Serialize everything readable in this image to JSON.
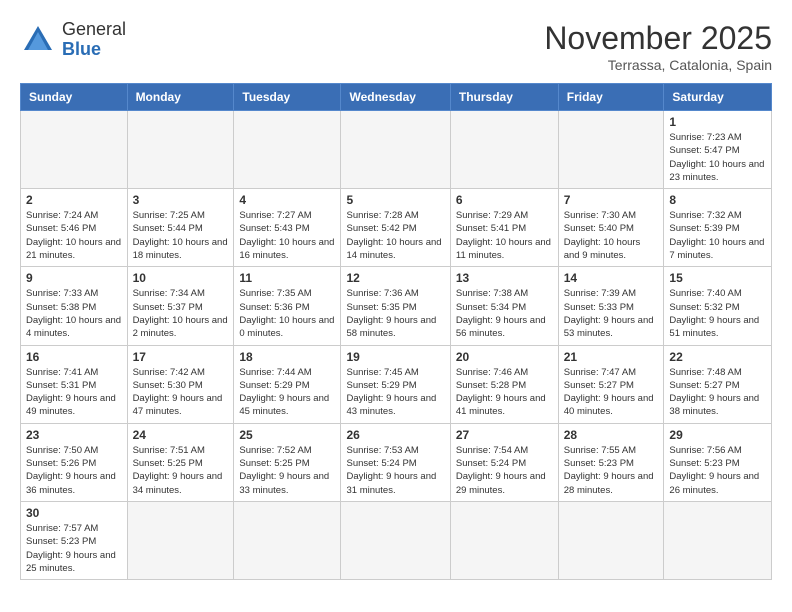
{
  "header": {
    "logo_general": "General",
    "logo_blue": "Blue",
    "month_title": "November 2025",
    "location": "Terrassa, Catalonia, Spain"
  },
  "days_of_week": [
    "Sunday",
    "Monday",
    "Tuesday",
    "Wednesday",
    "Thursday",
    "Friday",
    "Saturday"
  ],
  "weeks": [
    [
      {
        "day": "",
        "info": ""
      },
      {
        "day": "",
        "info": ""
      },
      {
        "day": "",
        "info": ""
      },
      {
        "day": "",
        "info": ""
      },
      {
        "day": "",
        "info": ""
      },
      {
        "day": "",
        "info": ""
      },
      {
        "day": "1",
        "info": "Sunrise: 7:23 AM\nSunset: 5:47 PM\nDaylight: 10 hours and 23 minutes."
      }
    ],
    [
      {
        "day": "2",
        "info": "Sunrise: 7:24 AM\nSunset: 5:46 PM\nDaylight: 10 hours and 21 minutes."
      },
      {
        "day": "3",
        "info": "Sunrise: 7:25 AM\nSunset: 5:44 PM\nDaylight: 10 hours and 18 minutes."
      },
      {
        "day": "4",
        "info": "Sunrise: 7:27 AM\nSunset: 5:43 PM\nDaylight: 10 hours and 16 minutes."
      },
      {
        "day": "5",
        "info": "Sunrise: 7:28 AM\nSunset: 5:42 PM\nDaylight: 10 hours and 14 minutes."
      },
      {
        "day": "6",
        "info": "Sunrise: 7:29 AM\nSunset: 5:41 PM\nDaylight: 10 hours and 11 minutes."
      },
      {
        "day": "7",
        "info": "Sunrise: 7:30 AM\nSunset: 5:40 PM\nDaylight: 10 hours and 9 minutes."
      },
      {
        "day": "8",
        "info": "Sunrise: 7:32 AM\nSunset: 5:39 PM\nDaylight: 10 hours and 7 minutes."
      }
    ],
    [
      {
        "day": "9",
        "info": "Sunrise: 7:33 AM\nSunset: 5:38 PM\nDaylight: 10 hours and 4 minutes."
      },
      {
        "day": "10",
        "info": "Sunrise: 7:34 AM\nSunset: 5:37 PM\nDaylight: 10 hours and 2 minutes."
      },
      {
        "day": "11",
        "info": "Sunrise: 7:35 AM\nSunset: 5:36 PM\nDaylight: 10 hours and 0 minutes."
      },
      {
        "day": "12",
        "info": "Sunrise: 7:36 AM\nSunset: 5:35 PM\nDaylight: 9 hours and 58 minutes."
      },
      {
        "day": "13",
        "info": "Sunrise: 7:38 AM\nSunset: 5:34 PM\nDaylight: 9 hours and 56 minutes."
      },
      {
        "day": "14",
        "info": "Sunrise: 7:39 AM\nSunset: 5:33 PM\nDaylight: 9 hours and 53 minutes."
      },
      {
        "day": "15",
        "info": "Sunrise: 7:40 AM\nSunset: 5:32 PM\nDaylight: 9 hours and 51 minutes."
      }
    ],
    [
      {
        "day": "16",
        "info": "Sunrise: 7:41 AM\nSunset: 5:31 PM\nDaylight: 9 hours and 49 minutes."
      },
      {
        "day": "17",
        "info": "Sunrise: 7:42 AM\nSunset: 5:30 PM\nDaylight: 9 hours and 47 minutes."
      },
      {
        "day": "18",
        "info": "Sunrise: 7:44 AM\nSunset: 5:29 PM\nDaylight: 9 hours and 45 minutes."
      },
      {
        "day": "19",
        "info": "Sunrise: 7:45 AM\nSunset: 5:29 PM\nDaylight: 9 hours and 43 minutes."
      },
      {
        "day": "20",
        "info": "Sunrise: 7:46 AM\nSunset: 5:28 PM\nDaylight: 9 hours and 41 minutes."
      },
      {
        "day": "21",
        "info": "Sunrise: 7:47 AM\nSunset: 5:27 PM\nDaylight: 9 hours and 40 minutes."
      },
      {
        "day": "22",
        "info": "Sunrise: 7:48 AM\nSunset: 5:27 PM\nDaylight: 9 hours and 38 minutes."
      }
    ],
    [
      {
        "day": "23",
        "info": "Sunrise: 7:50 AM\nSunset: 5:26 PM\nDaylight: 9 hours and 36 minutes."
      },
      {
        "day": "24",
        "info": "Sunrise: 7:51 AM\nSunset: 5:25 PM\nDaylight: 9 hours and 34 minutes."
      },
      {
        "day": "25",
        "info": "Sunrise: 7:52 AM\nSunset: 5:25 PM\nDaylight: 9 hours and 33 minutes."
      },
      {
        "day": "26",
        "info": "Sunrise: 7:53 AM\nSunset: 5:24 PM\nDaylight: 9 hours and 31 minutes."
      },
      {
        "day": "27",
        "info": "Sunrise: 7:54 AM\nSunset: 5:24 PM\nDaylight: 9 hours and 29 minutes."
      },
      {
        "day": "28",
        "info": "Sunrise: 7:55 AM\nSunset: 5:23 PM\nDaylight: 9 hours and 28 minutes."
      },
      {
        "day": "29",
        "info": "Sunrise: 7:56 AM\nSunset: 5:23 PM\nDaylight: 9 hours and 26 minutes."
      }
    ],
    [
      {
        "day": "30",
        "info": "Sunrise: 7:57 AM\nSunset: 5:23 PM\nDaylight: 9 hours and 25 minutes."
      },
      {
        "day": "",
        "info": ""
      },
      {
        "day": "",
        "info": ""
      },
      {
        "day": "",
        "info": ""
      },
      {
        "day": "",
        "info": ""
      },
      {
        "day": "",
        "info": ""
      },
      {
        "day": "",
        "info": ""
      }
    ]
  ]
}
